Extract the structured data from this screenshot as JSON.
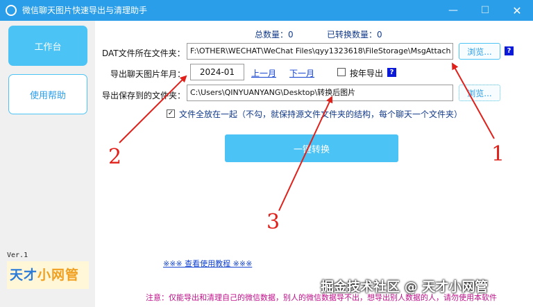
{
  "window": {
    "title": "微信聊天图片快速导出与清理助手",
    "minimize": "—",
    "maximize": "☐",
    "close": "✕"
  },
  "sidebar": {
    "items": [
      {
        "label": "工作台",
        "active": true
      },
      {
        "label": "使用帮助",
        "active": false
      }
    ],
    "version": "Ver.1",
    "brand_part1": "天才",
    "brand_part2": "小网管"
  },
  "stats": {
    "total": "总数量：0",
    "converted": "已转换数量：0"
  },
  "form": {
    "dat_label": "DAT文件所在文件夹：",
    "dat_path": "F:\\OTHER\\WECHAT\\WeChat Files\\qyy1323618\\FileStorage\\MsgAttach",
    "month_label": "导出聊天图片年月：",
    "month_value": "2024-01",
    "prev_month": "上一月",
    "next_month": "下一月",
    "by_year_label": "按年导出",
    "save_label": "导出保存到的文件夹：",
    "save_path": "C:\\Users\\QINYUANYANG\\Desktop\\转换后图片",
    "browse": "浏览...",
    "help": "?",
    "all_in_one_label": "文件全放在一起（不勾，就保持源文件文件夹的结构，每个聊天一个文件夹）",
    "convert_button": "一键转换"
  },
  "footer": {
    "usage_link": "※※※  查看使用教程 ※※※",
    "notice": "注意：仅能导出和清理自己的微信数据，别人的微信数据导不出，想导出别人数据的人，请勿使用本软件",
    "watermark": "掘金技术社区 @ 天才小网管"
  },
  "annotations": [
    "1",
    "2",
    "3"
  ],
  "colors": {
    "titlebar": "#2a9ee8",
    "accent": "#4cc3f5",
    "annotation": "#e0201a",
    "notice": "#c0108a"
  }
}
